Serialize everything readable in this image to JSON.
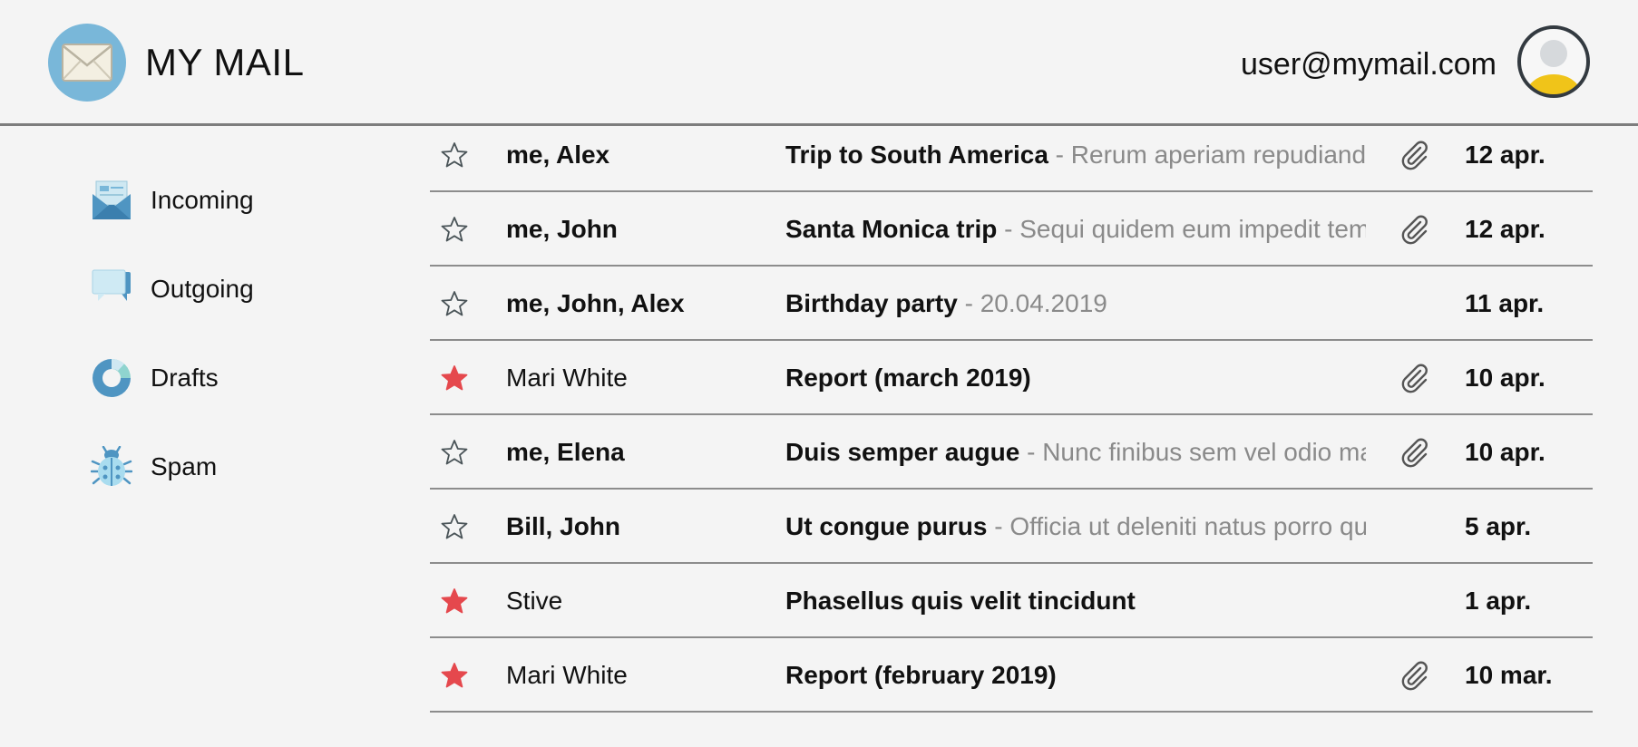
{
  "header": {
    "title": "MY MAIL",
    "user_email": "user@mymail.com",
    "logo_icon": "envelope-icon",
    "avatar_icon": "user-avatar-icon"
  },
  "sidebar": {
    "items": [
      {
        "label": "Incoming",
        "icon": "inbox-envelope-icon"
      },
      {
        "label": "Outgoing",
        "icon": "chat-bubbles-icon"
      },
      {
        "label": "Drafts",
        "icon": "donut-chart-icon"
      },
      {
        "label": "Spam",
        "icon": "bug-icon"
      }
    ]
  },
  "colors": {
    "background": "#f4f4f4",
    "accent_blue": "#79b7d9",
    "star_active": "#e5484d",
    "preview_text": "#8a8a8a",
    "divider": "#8c8c8c",
    "avatar_yellow": "#f0c419"
  },
  "mails": [
    {
      "starred": false,
      "sender": "me, Alex",
      "subject": "Trip to South America",
      "preview": " - Rerum aperiam repudiandae",
      "attachment": true,
      "date": "12 apr."
    },
    {
      "starred": false,
      "sender": "me, John",
      "subject": "Santa Monica trip",
      "preview": " - Sequi quidem eum impedit tempora",
      "attachment": true,
      "date": "12 apr."
    },
    {
      "starred": false,
      "sender": "me, John, Alex",
      "subject": "Birthday party",
      "preview": " - 20.04.2019",
      "attachment": false,
      "date": "11 apr."
    },
    {
      "starred": true,
      "sender": "Mari White",
      "subject": "Report (march 2019)",
      "preview": "",
      "attachment": true,
      "date": "10 apr."
    },
    {
      "starred": false,
      "sender": "me, Elena",
      "subject": "Duis semper augue",
      "preview": " - Nunc finibus sem vel odio mattis",
      "attachment": true,
      "date": "10 apr."
    },
    {
      "starred": false,
      "sender": "Bill, John",
      "subject": "Ut congue purus",
      "preview": " - Officia ut deleniti natus porro quia",
      "attachment": false,
      "date": "5 apr."
    },
    {
      "starred": true,
      "sender": "Stive",
      "subject": "Phasellus quis velit tincidunt",
      "preview": "",
      "attachment": false,
      "date": "1 apr."
    },
    {
      "starred": true,
      "sender": "Mari White",
      "subject": "Report (february 2019)",
      "preview": "",
      "attachment": true,
      "date": "10 mar."
    }
  ]
}
